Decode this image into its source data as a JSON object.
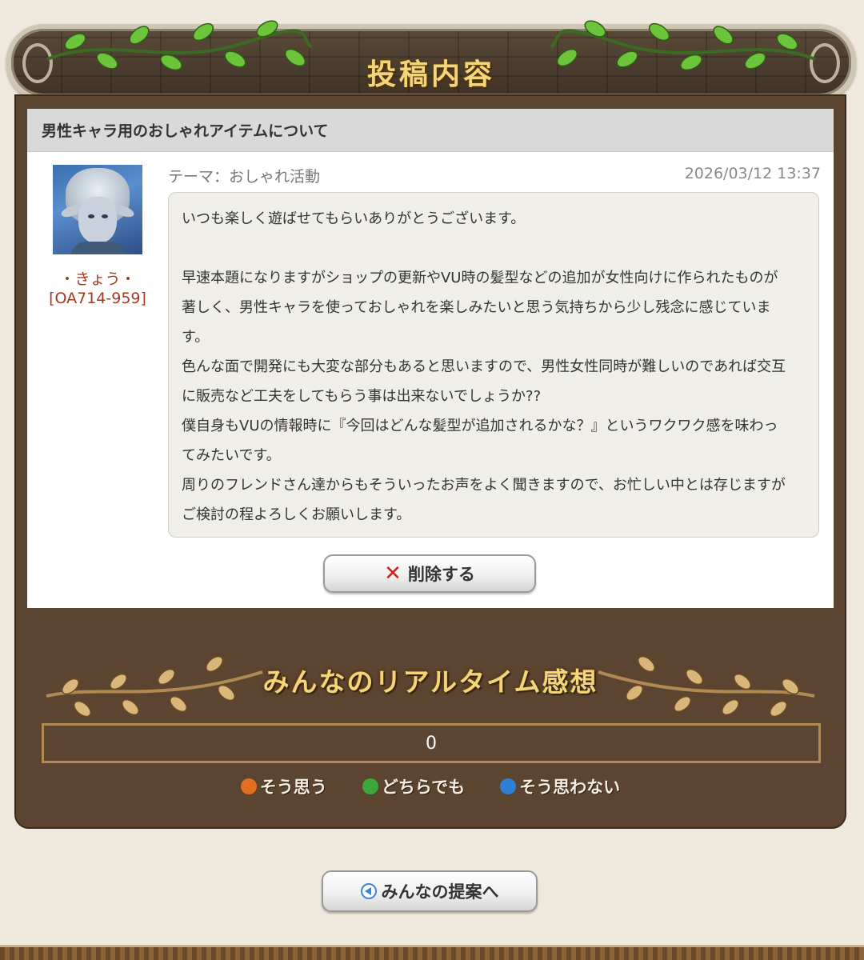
{
  "header": {
    "title": "投稿内容"
  },
  "post": {
    "title": "男性キャラ用のおしゃれアイテムについて",
    "author_name": "・きょう・",
    "author_id": "[OA714-959]",
    "theme": "テーマ：おしゃれ活動",
    "date": "2026/03/12 13:37",
    "body": [
      "いつも楽しく遊ばせてもらいありがとうございます。",
      "",
      "早速本題になりますがショップの更新やVU時の髪型などの追加が女性向けに作られたものが",
      "著しく、男性キャラを使っておしゃれを楽しみたいと思う気持ちから少し残念に感じていま",
      "す。",
      "色んな面で開発にも大変な部分もあると思いますので、男性女性同時が難しいのであれば交互",
      "に販売など工夫をしてもらう事は出来ないでしょうか??",
      "僕自身もVUの情報時に『今回はどんな髪型が追加されるかな？』というワクワク感を味わっ",
      "てみたいです。",
      "周りのフレンドさん達からもそういったお声をよく聞きますので、お忙しい中とは存じますが",
      "ご検討の程よろしくお願いします。"
    ],
    "delete_label": "削除する"
  },
  "realtime": {
    "title": "みんなのリアルタイム感想",
    "count": "0",
    "legend": [
      {
        "label": "そう思う",
        "color": "#e07020"
      },
      {
        "label": "どちらでも",
        "color": "#3aa83a"
      },
      {
        "label": "そう思わない",
        "color": "#2f7fd6"
      }
    ]
  },
  "nav": {
    "back_label": "みんなの提案へ"
  },
  "colors": {
    "panel": "#5c4530",
    "gold_text": "#f4d67a",
    "user_text": "#a33a1e",
    "delete_icon": "#d0221b"
  }
}
